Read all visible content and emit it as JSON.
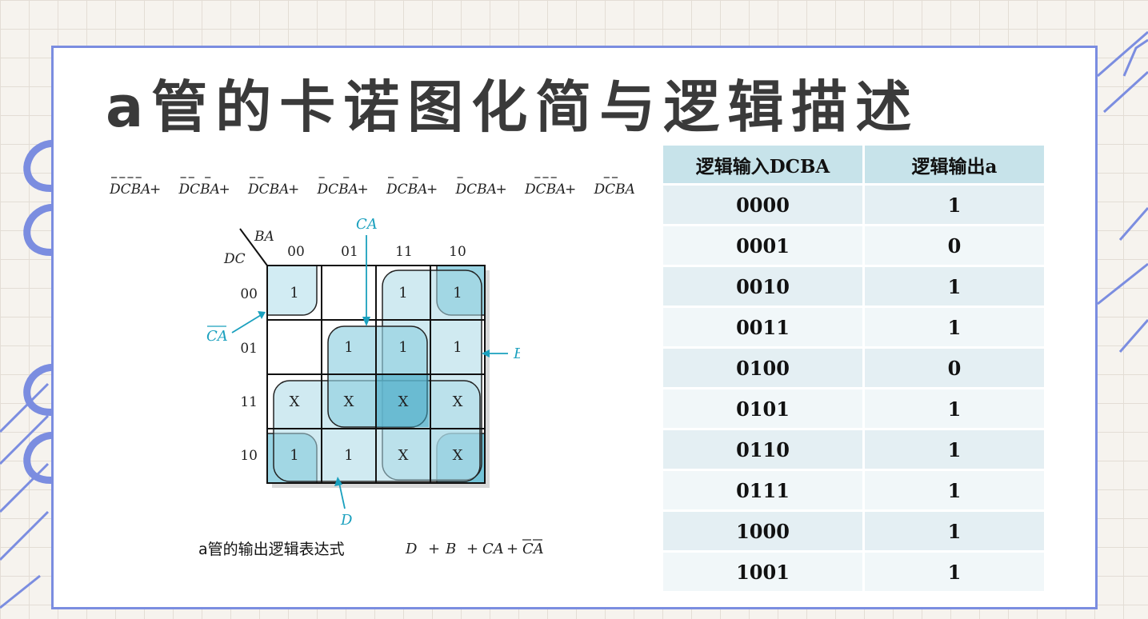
{
  "title": "a管的卡诺图化简与逻辑描述",
  "minterm_expression": [
    {
      "text": "DCBA",
      "bars": [
        0,
        1,
        2,
        3
      ]
    },
    {
      "text": "DCBA",
      "bars": [
        0,
        1,
        3
      ]
    },
    {
      "text": "DCBA",
      "bars": [
        0,
        1
      ]
    },
    {
      "text": "DCBA",
      "bars": [
        0,
        3
      ]
    },
    {
      "text": "DCBA",
      "bars": [
        0,
        3
      ]
    },
    {
      "text": "DCBA",
      "bars": [
        0
      ]
    },
    {
      "text": "DCBA",
      "bars": [
        1,
        2,
        3
      ]
    },
    {
      "text": "DCBA",
      "bars": [
        1,
        2
      ]
    }
  ],
  "kmap": {
    "row_var": "DC",
    "col_var": "BA",
    "col_labels": [
      "00",
      "01",
      "11",
      "10"
    ],
    "row_labels": [
      "00",
      "01",
      "11",
      "10"
    ],
    "cells": [
      [
        "1",
        "",
        "1",
        "1"
      ],
      [
        "",
        "1",
        "1",
        "1"
      ],
      [
        "X",
        "X",
        "X",
        "X"
      ],
      [
        "1",
        "1",
        "X",
        "X"
      ]
    ],
    "annotations": {
      "ca": "CA",
      "not_c_not_a": "CA",
      "b": "B",
      "d": "D"
    },
    "accent_color": "#1aa0be"
  },
  "expression": {
    "label": "a管的输出逻辑表达式",
    "terms": [
      "D",
      "+",
      "B",
      "+",
      "CA",
      "+",
      "CA"
    ]
  },
  "truth_table": {
    "headers": [
      "逻辑输入DCBA",
      "逻辑输出a"
    ],
    "rows": [
      [
        "0000",
        "1"
      ],
      [
        "0001",
        "0"
      ],
      [
        "0010",
        "1"
      ],
      [
        "0011",
        "1"
      ],
      [
        "0100",
        "0"
      ],
      [
        "0101",
        "1"
      ],
      [
        "0110",
        "1"
      ],
      [
        "0111",
        "1"
      ],
      [
        "1000",
        "1"
      ],
      [
        "1001",
        "1"
      ]
    ]
  },
  "colors": {
    "card_border": "#7b8de0",
    "header_bg": "#c7e3ea",
    "row_bg_odd": "#e4eff3",
    "row_bg_even": "#f1f7f9"
  }
}
